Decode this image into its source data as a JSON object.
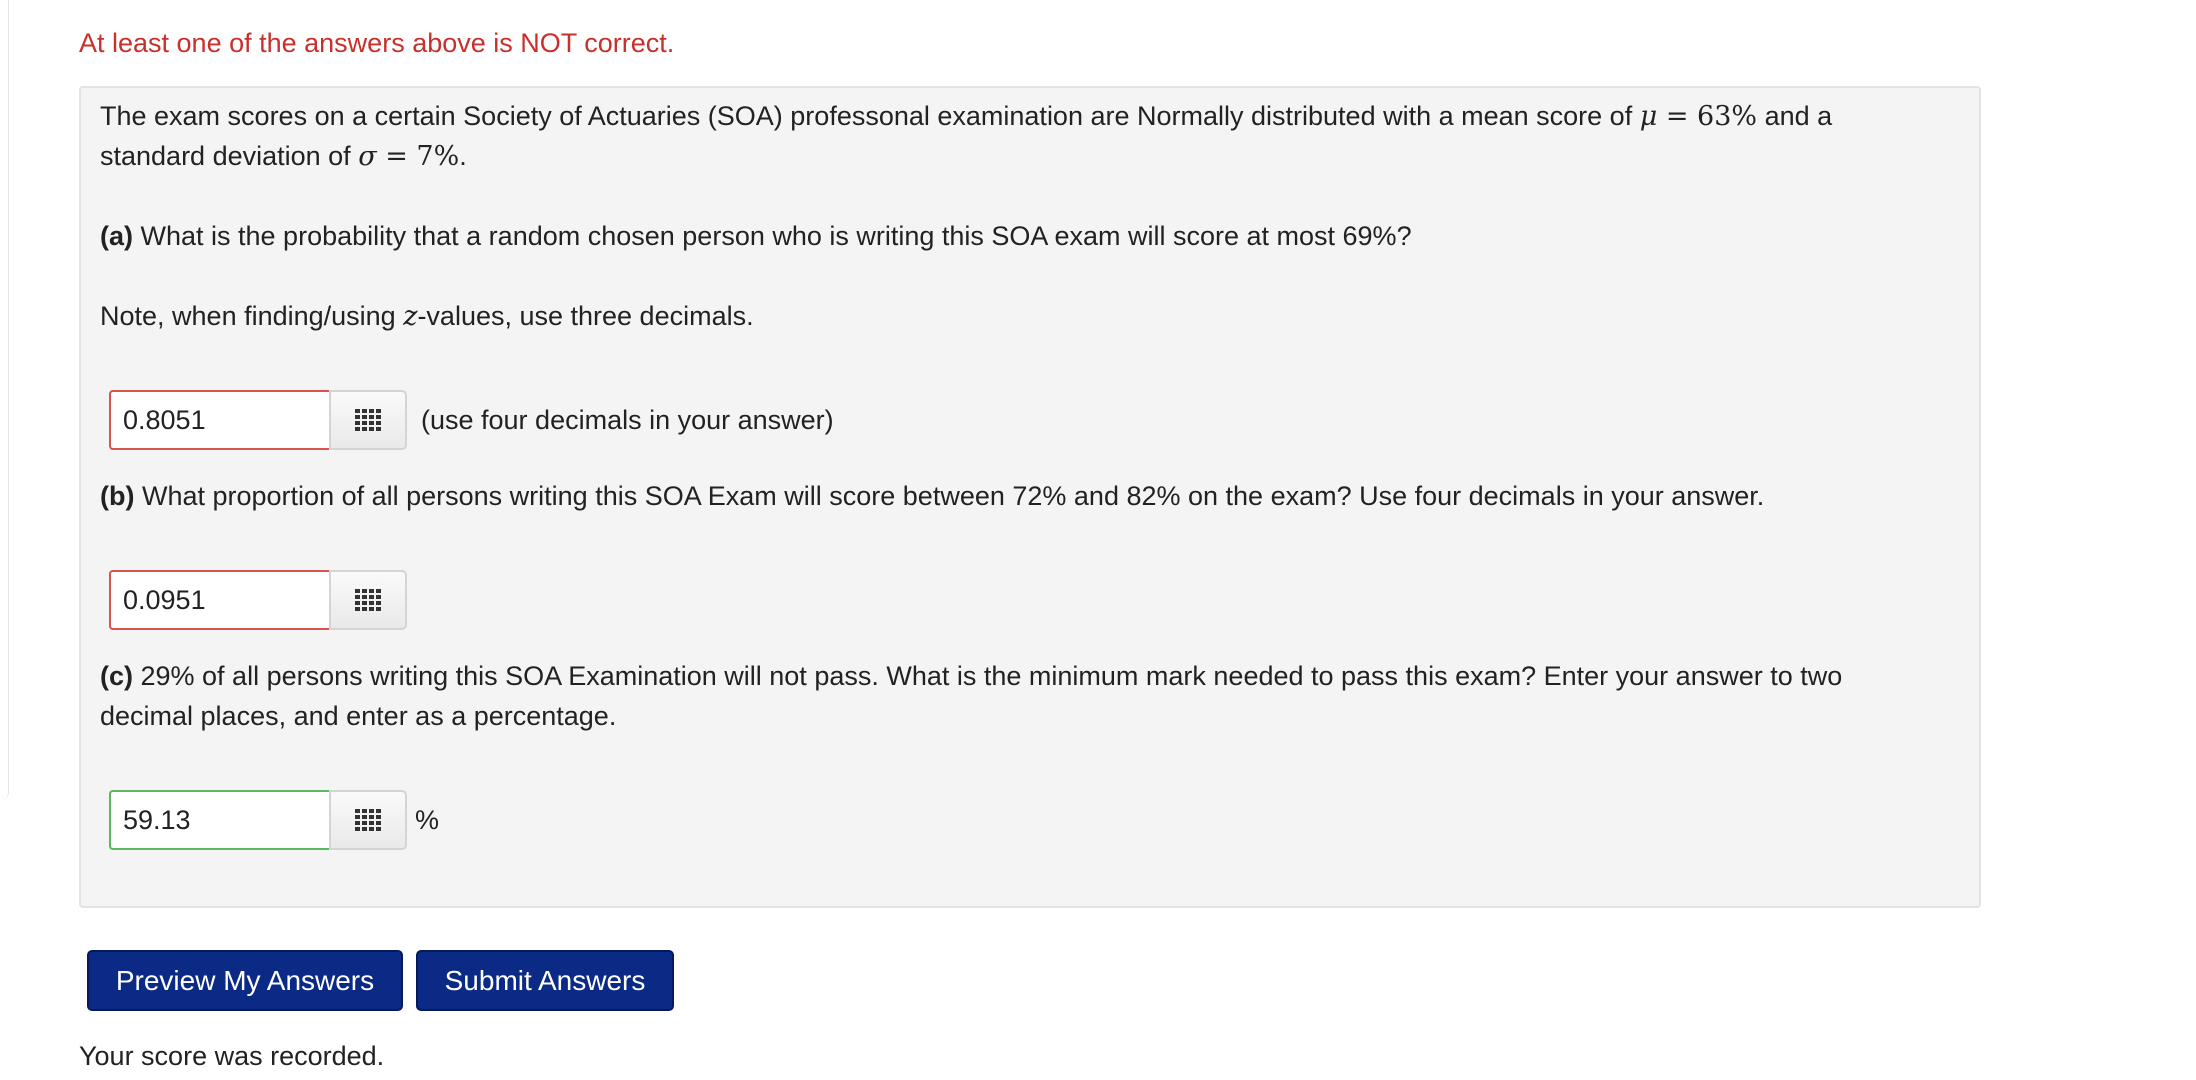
{
  "alert": "At least one of the answers above is NOT correct.",
  "problem": {
    "intro_1": "The exam scores on a certain Society of Actuaries (SOA) professonal examination are Normally distributed with a mean score of ",
    "mu_symbol": "μ",
    "mu_value": " = 63%",
    "intro_2": " and a",
    "intro_3": "standard deviation of ",
    "sigma_symbol": "σ",
    "sigma_value": " = 7%",
    "intro_4": ".",
    "a_label": "(a)",
    "a_text": " What is the probability that a random chosen person who is writing this SOA exam will score at most 69%?",
    "note_1": "Note, when finding/using ",
    "note_z": "z",
    "note_2": "-values, use three decimals.",
    "a_answer": "0.8051",
    "a_hint": "(use four decimals in your answer)",
    "b_label": "(b)",
    "b_text": " What proportion of all persons writing this SOA Exam will score between 72% and 82% on the exam? Use four decimals in your answer.",
    "b_answer": "0.0951",
    "c_label": "(c)",
    "c_text_1": " 29% of all persons writing this SOA Examination will not pass. What is the minimum mark needed to pass this exam? Enter your answer to two",
    "c_text_2": "decimal places, and enter as a percentage.",
    "c_answer": "59.13",
    "c_unit": "%"
  },
  "buttons": {
    "preview": "Preview My Answers",
    "submit": "Submit Answers"
  },
  "status": "Your score was recorded.",
  "icons": {
    "answer_tool": "grid-icon"
  },
  "colors": {
    "incorrect": "#d9534f",
    "correct": "#5cb85c",
    "button": "#0b2a86",
    "alert": "#c9302c"
  }
}
